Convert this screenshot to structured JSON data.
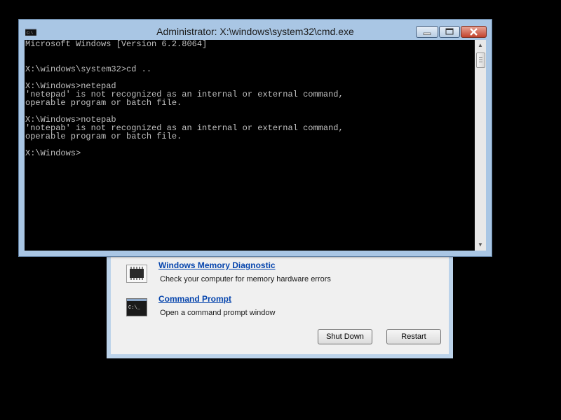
{
  "cmd_window": {
    "title": "Administrator: X:\\windows\\system32\\cmd.exe",
    "icon": "cmd-app-icon",
    "console_lines": [
      "Microsoft Windows [Version 6.2.8064]",
      "",
      "",
      "X:\\windows\\system32>cd ..",
      "",
      "X:\\Windows>netepad",
      "'netepad' is not recognized as an internal or external command,",
      "operable program or batch file.",
      "",
      "X:\\Windows>notepab",
      "'notepab' is not recognized as an internal or external command,",
      "operable program or batch file.",
      "",
      "X:\\Windows>"
    ]
  },
  "recovery_tools": [
    {
      "icon": "memory-chip-icon",
      "link": "Windows Memory Diagnostic",
      "description": "Check your computer for memory hardware errors"
    },
    {
      "icon": "command-prompt-icon",
      "link": "Command Prompt",
      "description": "Open a command prompt window"
    }
  ],
  "buttons": {
    "shutdown": "Shut Down",
    "restart": "Restart"
  },
  "colors": {
    "console_bg": "#000000",
    "console_text": "#c0c0c0",
    "window_frame": "#a9c6e4",
    "link": "#0645ad"
  }
}
